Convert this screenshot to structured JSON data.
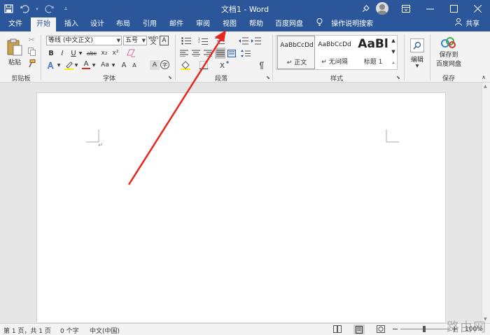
{
  "title_bar": {
    "title": "文档1 - Word",
    "qat": [
      "save-icon",
      "undo-icon",
      "redo-icon",
      "customize-icon"
    ],
    "buttons": [
      "ribbon-display-icon",
      "minimize-icon",
      "maximize-icon",
      "close-icon"
    ]
  },
  "tabs": [
    {
      "label": "文件",
      "active": false
    },
    {
      "label": "开始",
      "active": true
    },
    {
      "label": "插入",
      "active": false
    },
    {
      "label": "设计",
      "active": false
    },
    {
      "label": "布局",
      "active": false
    },
    {
      "label": "引用",
      "active": false
    },
    {
      "label": "邮件",
      "active": false
    },
    {
      "label": "审阅",
      "active": false
    },
    {
      "label": "视图",
      "active": false
    },
    {
      "label": "帮助",
      "active": false
    },
    {
      "label": "百度网盘",
      "active": false
    }
  ],
  "tell_me": "操作说明搜索",
  "share": "共享",
  "ribbon": {
    "clipboard": {
      "paste": "粘贴",
      "label": "剪贴板"
    },
    "font": {
      "font_name": "等线 (中文正文)",
      "font_size": "五号",
      "label": "字体",
      "bold": "B",
      "italic": "I",
      "underline": "U",
      "strike": "abc",
      "subscript": "x₂",
      "superscript": "x²",
      "font_color": "A",
      "change_case": "Aa",
      "grow": "A",
      "shrink": "A",
      "pinyin": "wén",
      "clear": "A"
    },
    "paragraph": {
      "label": "段落"
    },
    "styles": {
      "label": "样式",
      "items": [
        {
          "sample": "AaBbCcDd",
          "name": "↵ 正文"
        },
        {
          "sample": "AaBbCcDd",
          "name": "↵ 无间隔"
        },
        {
          "sample": "AaBl",
          "name": "标题 1"
        }
      ]
    },
    "editing": {
      "label": "编辑"
    },
    "save": {
      "label1": "保存到",
      "label2": "百度网盘",
      "group": "保存"
    }
  },
  "status_bar": {
    "page": "第 1 页，共 1 页",
    "words": "0 个字",
    "language": "中文(中国)",
    "zoom": "100%"
  },
  "watermark": "路由网",
  "colors": {
    "accent": "#2b579a",
    "arrow": "#e8261f",
    "ribbon_bg": "#f3f3f3"
  }
}
